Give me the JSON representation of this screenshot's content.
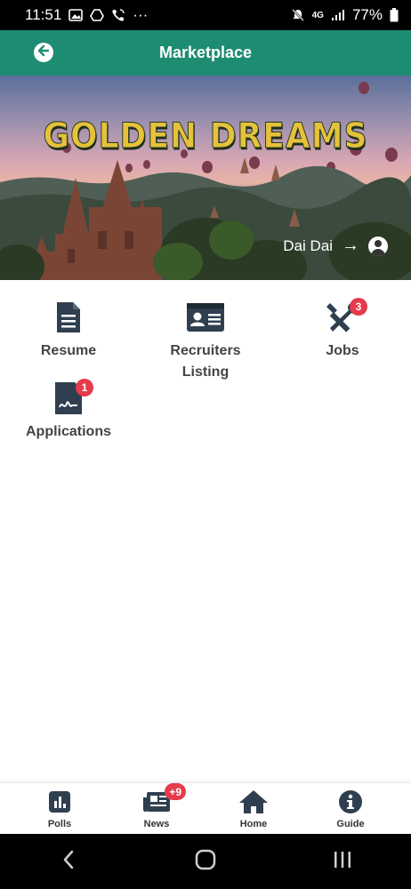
{
  "status_bar": {
    "time": "11:51",
    "more": "···",
    "network": "4G",
    "battery": "77%"
  },
  "header": {
    "title": "Marketplace",
    "back_icon": "arrow-left-circle-icon"
  },
  "banner": {
    "title": "GOLDEN DREAMS",
    "user_name": "Dai Dai",
    "user_arrow": "→",
    "user_icon": "user-circle-icon"
  },
  "tiles": [
    {
      "label": "Resume",
      "icon": "file-icon"
    },
    {
      "label": "Recruiters Listing",
      "icon": "id-card-icon"
    },
    {
      "label": "Jobs",
      "icon": "tools-icon",
      "badge": "3"
    },
    {
      "label": "Applications",
      "icon": "signed-document-icon",
      "badge": "1"
    }
  ],
  "bottom_nav": [
    {
      "label": "Polls",
      "icon": "poll-icon"
    },
    {
      "label": "News",
      "icon": "newspaper-icon",
      "badge": "+9"
    },
    {
      "label": "Home",
      "icon": "home-icon"
    },
    {
      "label": "Guide",
      "icon": "info-circle-icon"
    }
  ],
  "colors": {
    "header": "#1e8c72",
    "icon": "#2f3f4f",
    "badge": "#e53b4a"
  }
}
